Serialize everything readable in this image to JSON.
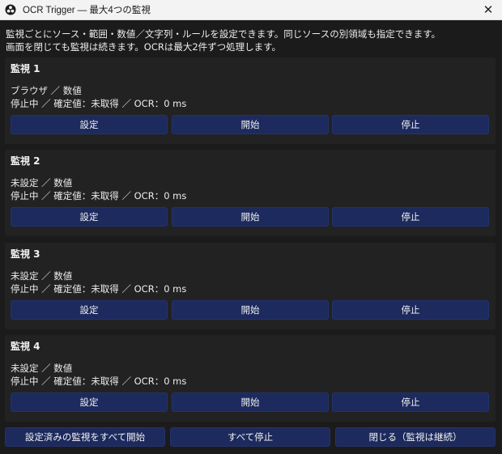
{
  "window": {
    "title": "OCR Trigger — 最大4つの監視",
    "close_symbol": "✕"
  },
  "intro": {
    "line1": "監視ごとにソース・範囲・数値／文字列・ルールを設定できます。同じソースの別領域も指定できます。",
    "line2": "画面を閉じても監視は続きます。OCRは最大2件ずつ処理します。"
  },
  "monitors": [
    {
      "title": "監視 1",
      "summary": "ブラウザ ／ 数値",
      "status": "停止中 ／ 確定値：未取得 ／ OCR：0 ms",
      "settings_label": "設定",
      "start_label": "開始",
      "stop_label": "停止"
    },
    {
      "title": "監視 2",
      "summary": "未設定 ／ 数値",
      "status": "停止中 ／ 確定値：未取得 ／ OCR：0 ms",
      "settings_label": "設定",
      "start_label": "開始",
      "stop_label": "停止"
    },
    {
      "title": "監視 3",
      "summary": "未設定 ／ 数値",
      "status": "停止中 ／ 確定値：未取得 ／ OCR：0 ms",
      "settings_label": "設定",
      "start_label": "開始",
      "stop_label": "停止"
    },
    {
      "title": "監視 4",
      "summary": "未設定 ／ 数値",
      "status": "停止中 ／ 確定値：未取得 ／ OCR：0 ms",
      "settings_label": "設定",
      "start_label": "開始",
      "stop_label": "停止"
    }
  ],
  "footer": {
    "start_all_label": "設定済みの監視をすべて開始",
    "stop_all_label": "すべて停止",
    "close_label": "閉じる（監視は継続）"
  },
  "colors": {
    "background": "#1b1b1b",
    "card": "#222222",
    "button": "#1d2a5e",
    "titlebar": "#f3f3f3"
  },
  "icons": {
    "app": "obs-logo-icon",
    "close": "close-icon"
  }
}
